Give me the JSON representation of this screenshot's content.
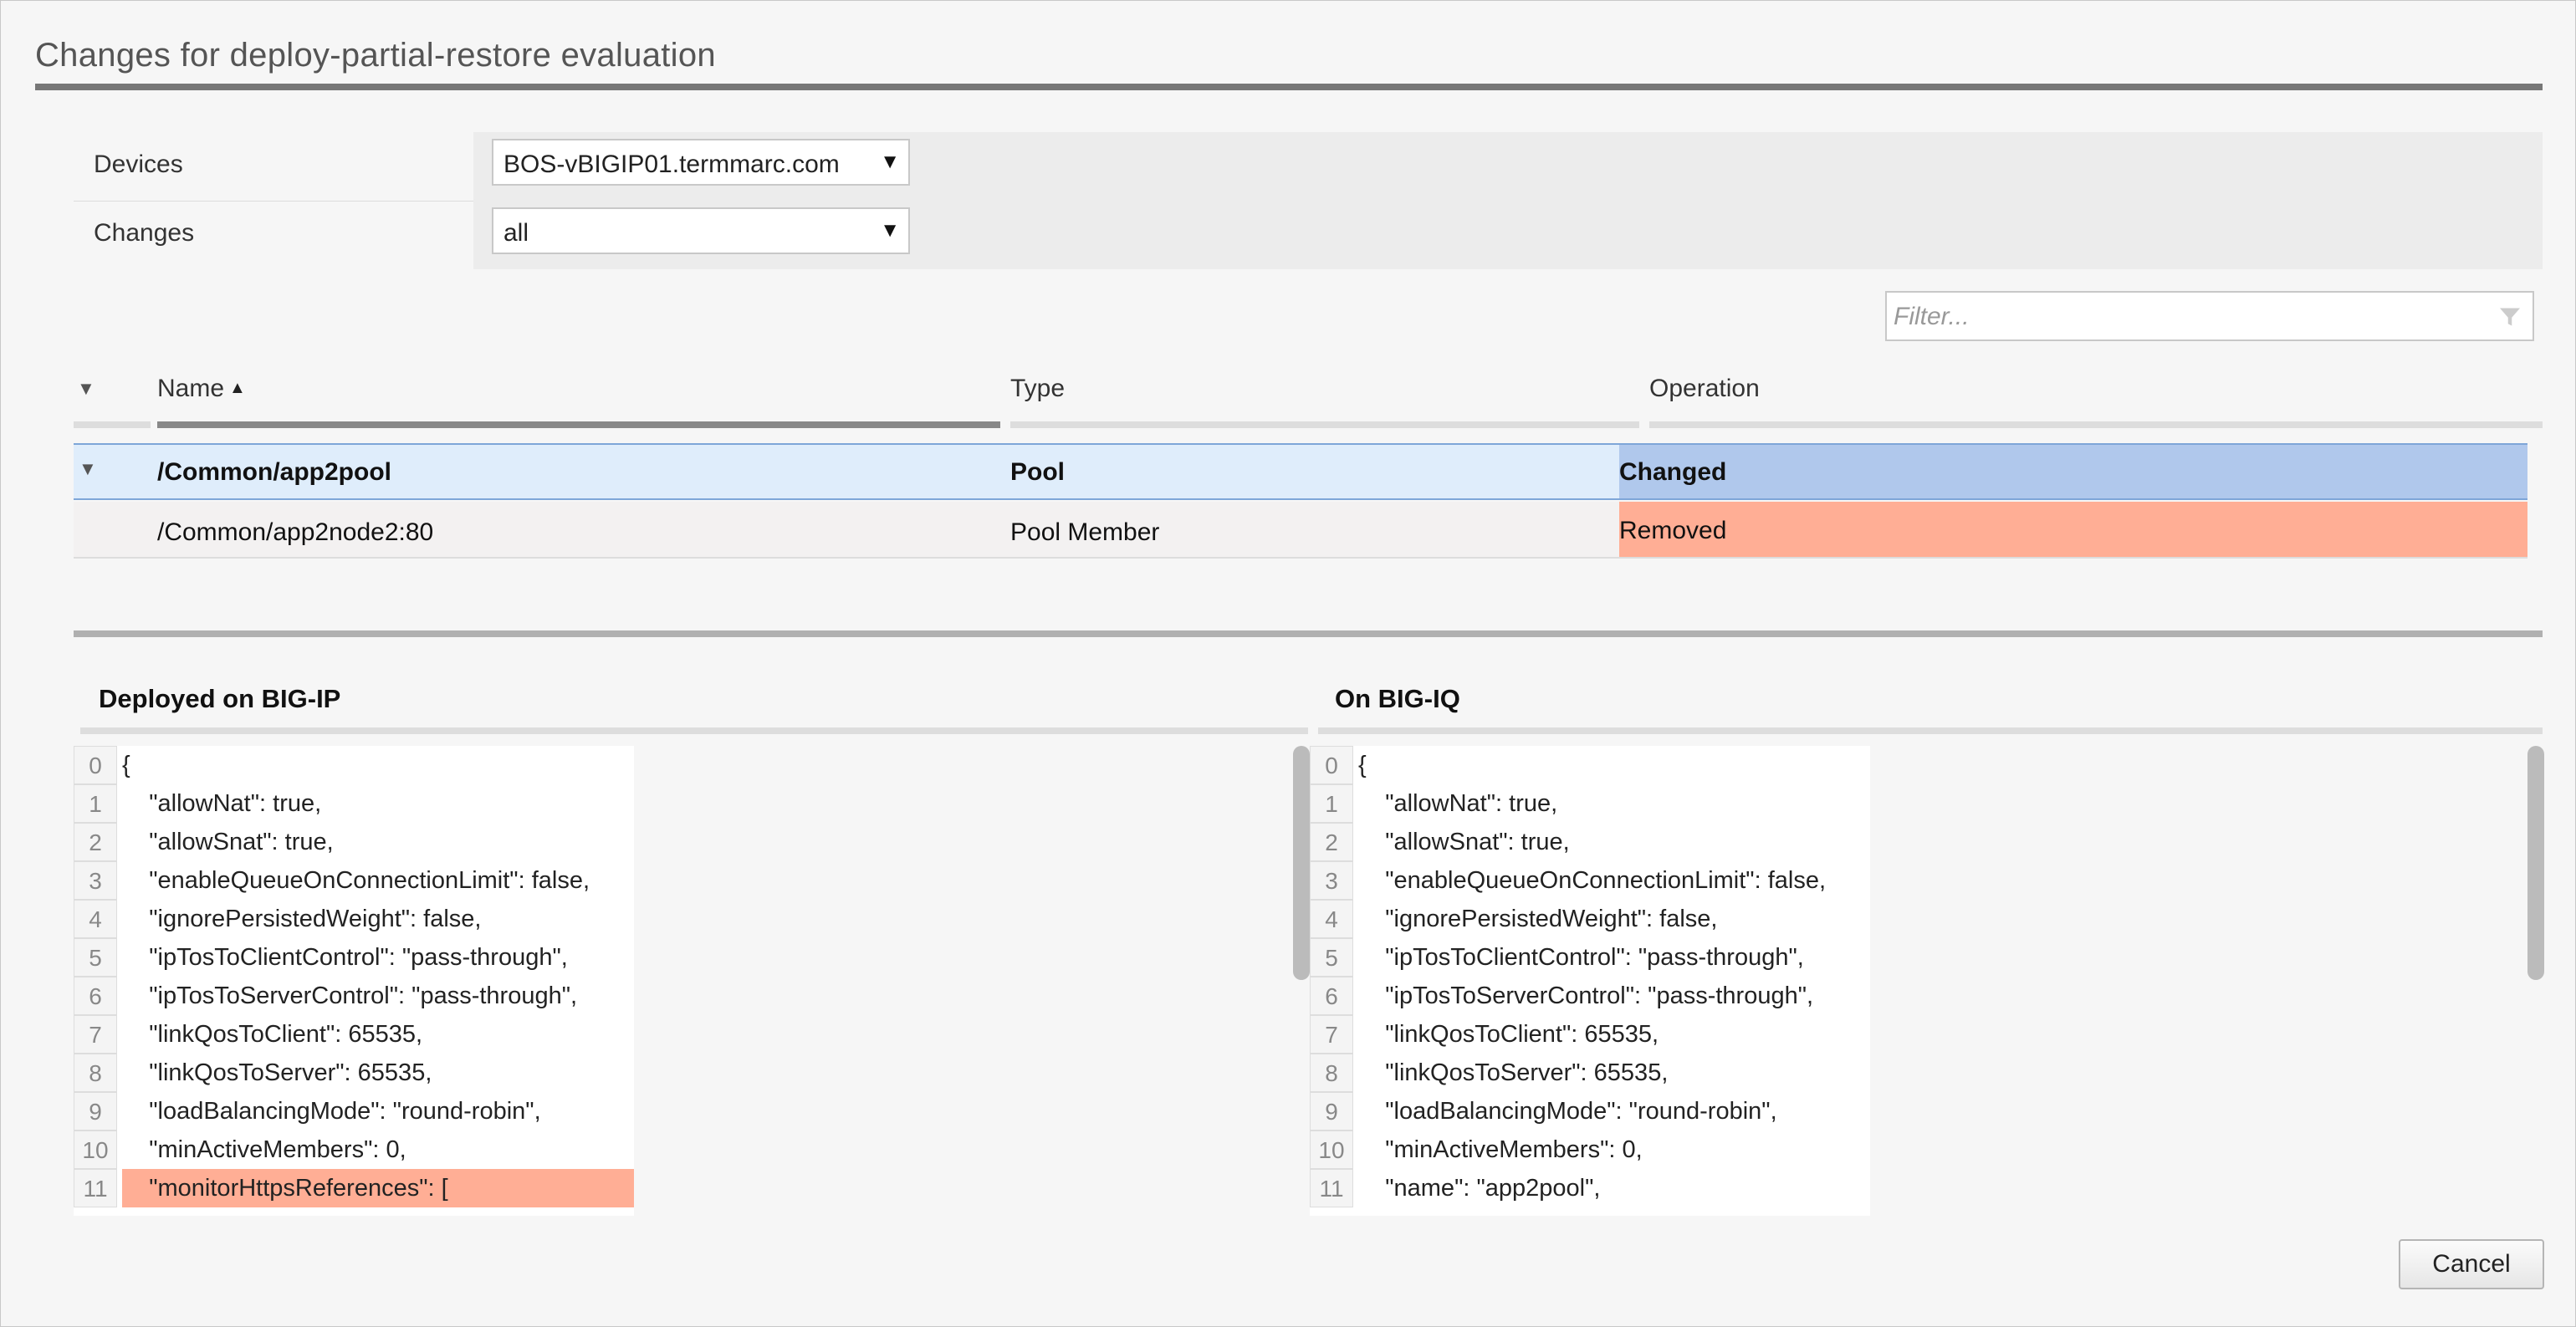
{
  "dialog": {
    "title": "Changes for deploy-partial-restore evaluation"
  },
  "form": {
    "devices_label": "Devices",
    "devices_value": "BOS-vBIGIP01.termmarc.com",
    "changes_label": "Changes",
    "changes_value": "all"
  },
  "filter": {
    "placeholder": "Filter..."
  },
  "table": {
    "columns": {
      "name": "Name",
      "type": "Type",
      "operation": "Operation"
    },
    "rows": [
      {
        "name": "/Common/app2pool",
        "type": "Pool",
        "operation": "Changed"
      },
      {
        "name": "/Common/app2node2:80",
        "type": "Pool Member",
        "operation": "Removed"
      }
    ]
  },
  "left_pane": {
    "title": "Deployed on BIG-IP",
    "lines": [
      {
        "n": "0",
        "text": "{"
      },
      {
        "n": "1",
        "text": "    \"allowNat\": true,"
      },
      {
        "n": "2",
        "text": "    \"allowSnat\": true,"
      },
      {
        "n": "3",
        "text": "    \"enableQueueOnConnectionLimit\": false,"
      },
      {
        "n": "4",
        "text": "    \"ignorePersistedWeight\": false,"
      },
      {
        "n": "5",
        "text": "    \"ipTosToClientControl\": \"pass-through\","
      },
      {
        "n": "6",
        "text": "    \"ipTosToServerControl\": \"pass-through\","
      },
      {
        "n": "7",
        "text": "    \"linkQosToClient\": 65535,"
      },
      {
        "n": "8",
        "text": "    \"linkQosToServer\": 65535,"
      },
      {
        "n": "9",
        "text": "    \"loadBalancingMode\": \"round-robin\","
      },
      {
        "n": "10",
        "text": "    \"minActiveMembers\": 0,"
      },
      {
        "n": "11",
        "text": "    \"monitorHttpsReferences\": [",
        "highlight": true
      }
    ]
  },
  "right_pane": {
    "title": "On BIG-IQ",
    "lines": [
      {
        "n": "0",
        "text": "{"
      },
      {
        "n": "1",
        "text": "    \"allowNat\": true,"
      },
      {
        "n": "2",
        "text": "    \"allowSnat\": true,"
      },
      {
        "n": "3",
        "text": "    \"enableQueueOnConnectionLimit\": false,"
      },
      {
        "n": "4",
        "text": "    \"ignorePersistedWeight\": false,"
      },
      {
        "n": "5",
        "text": "    \"ipTosToClientControl\": \"pass-through\","
      },
      {
        "n": "6",
        "text": "    \"ipTosToServerControl\": \"pass-through\","
      },
      {
        "n": "7",
        "text": "    \"linkQosToClient\": 65535,"
      },
      {
        "n": "8",
        "text": "    \"linkQosToServer\": 65535,"
      },
      {
        "n": "9",
        "text": "    \"loadBalancingMode\": \"round-robin\","
      },
      {
        "n": "10",
        "text": "    \"minActiveMembers\": 0,"
      },
      {
        "n": "11",
        "text": "    \"name\": \"app2pool\","
      }
    ]
  },
  "buttons": {
    "cancel": "Cancel"
  },
  "colors": {
    "changed": "#b0c8ec",
    "removed": "#ffae95",
    "selected_row": "#dfedfb"
  }
}
